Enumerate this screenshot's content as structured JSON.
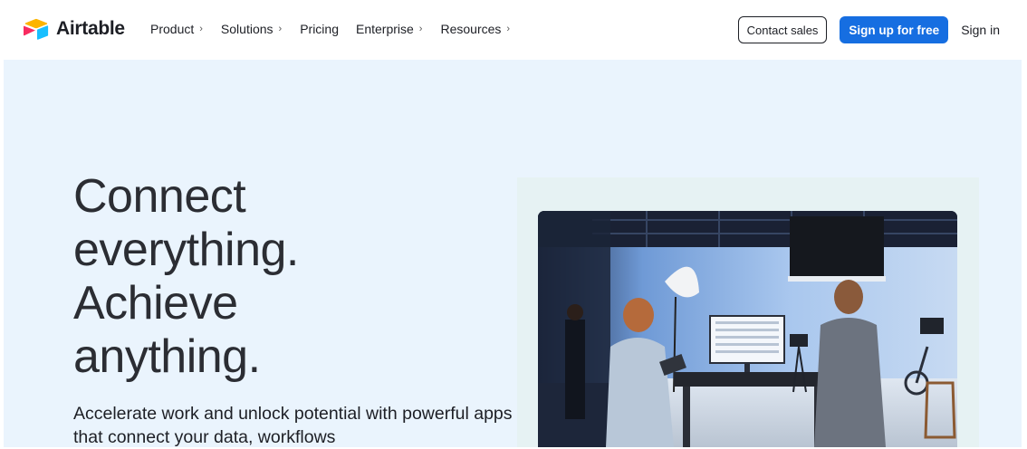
{
  "header": {
    "logo_text": "Airtable",
    "nav": [
      {
        "label": "Product",
        "has_chevron": true
      },
      {
        "label": "Solutions",
        "has_chevron": true
      },
      {
        "label": "Pricing",
        "has_chevron": false
      },
      {
        "label": "Enterprise",
        "has_chevron": true
      },
      {
        "label": "Resources",
        "has_chevron": true
      }
    ],
    "chevron_glyph": "›",
    "contact_sales_label": "Contact sales",
    "signup_label": "Sign up for free",
    "signin_label": "Sign in"
  },
  "hero": {
    "title_lines": [
      "Connect",
      "everything.",
      "Achieve",
      "anything."
    ],
    "subtitle": "Accelerate work and unlock potential with powerful apps that connect your data, workflows"
  },
  "colors": {
    "primary_blue": "#166ee1",
    "hero_background": "#eaf4fd",
    "media_panel": "#e6f2f3",
    "logo_yellow": "#fcb400",
    "logo_red": "#f82b60",
    "logo_blue": "#18bfff"
  },
  "icons": {
    "logo": "airtable-logo-icon",
    "chevron": "chevron-right-icon"
  }
}
